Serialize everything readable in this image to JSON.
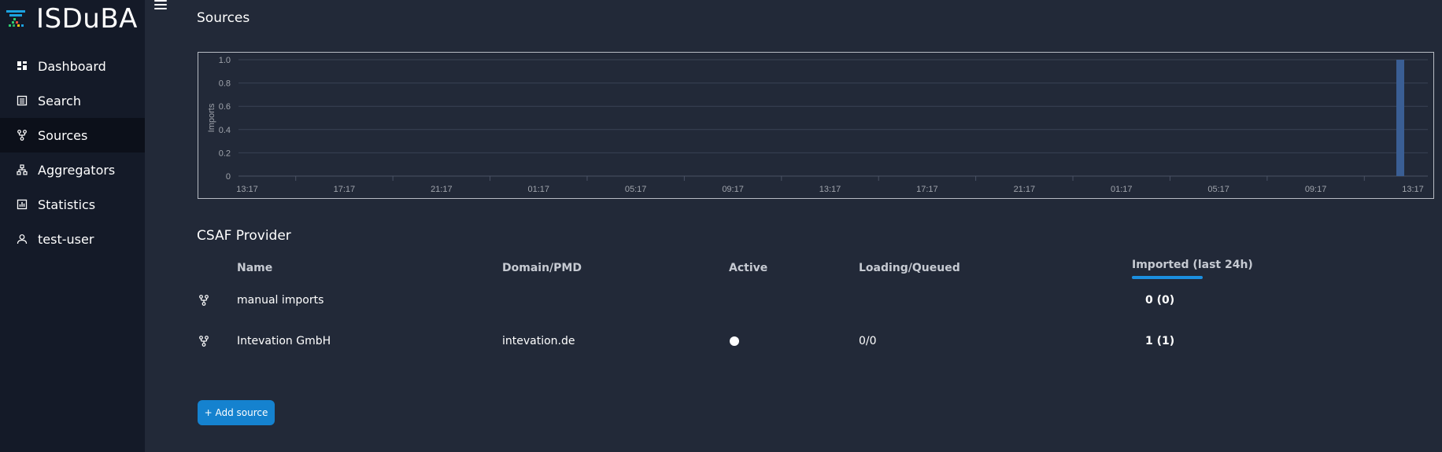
{
  "app": {
    "name": "ISDuBA"
  },
  "sidebar": {
    "items": [
      {
        "label": "Dashboard",
        "icon": "dashboard-icon"
      },
      {
        "label": "Search",
        "icon": "search-icon"
      },
      {
        "label": "Sources",
        "icon": "sources-icon",
        "active": true
      },
      {
        "label": "Aggregators",
        "icon": "aggregators-icon"
      },
      {
        "label": "Statistics",
        "icon": "statistics-icon"
      },
      {
        "label": "test-user",
        "icon": "user-icon"
      }
    ]
  },
  "page": {
    "title": "Sources"
  },
  "chart_data": {
    "type": "bar",
    "ylabel": "Imports",
    "ylim": [
      0,
      1.0
    ],
    "yticks": [
      "0",
      "0.2",
      "0.4",
      "0.6",
      "0.8",
      "1.0"
    ],
    "xticks": [
      "13:17",
      "17:17",
      "21:17",
      "01:17",
      "05:17",
      "09:17",
      "13:17",
      "17:17",
      "21:17",
      "01:17",
      "05:17",
      "09:17",
      "13:17"
    ],
    "values": [
      {
        "x": "13:17",
        "y": 1.0
      }
    ],
    "grid": true,
    "bar_color": "#3a5e94"
  },
  "provider_section": {
    "title": "CSAF Provider",
    "columns": [
      "Name",
      "Domain/PMD",
      "Active",
      "Loading/Queued",
      "Imported (last 24h)"
    ],
    "rows": [
      {
        "name": "manual imports",
        "domain": "",
        "active": false,
        "loading": "",
        "imported": "0 (0)"
      },
      {
        "name": "Intevation GmbH",
        "domain": "intevation.de",
        "active": true,
        "loading": "0/0",
        "imported": "1 (1)"
      }
    ]
  },
  "actions": {
    "add_source_label": "+ Add source"
  },
  "colors": {
    "accent": "#1582cf",
    "sidebar_bg": "#141a28",
    "main_bg": "#222938"
  }
}
